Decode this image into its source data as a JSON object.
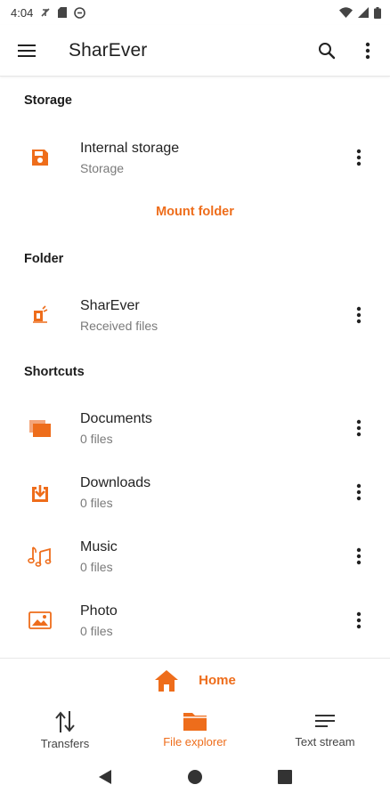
{
  "status_bar": {
    "time": "4:04"
  },
  "app_bar": {
    "title": "SharEver"
  },
  "sections": {
    "storage": {
      "title": "Storage",
      "items": [
        {
          "primary": "Internal storage",
          "secondary": "Storage",
          "icon": "save-icon"
        }
      ],
      "mount_label": "Mount folder"
    },
    "folder": {
      "title": "Folder",
      "items": [
        {
          "primary": "SharEver",
          "secondary": "Received files",
          "icon": "sharever-folder-icon"
        }
      ]
    },
    "shortcuts": {
      "title": "Shortcuts",
      "items": [
        {
          "primary": "Documents",
          "secondary": "0 files",
          "icon": "documents-icon"
        },
        {
          "primary": "Downloads",
          "secondary": "0 files",
          "icon": "download-icon"
        },
        {
          "primary": "Music",
          "secondary": "0 files",
          "icon": "music-icon"
        },
        {
          "primary": "Photo",
          "secondary": "0 files",
          "icon": "photo-icon"
        }
      ]
    }
  },
  "home_bar": {
    "label": "Home"
  },
  "bottom_nav": [
    {
      "label": "Transfers",
      "icon": "transfers-icon",
      "active": false
    },
    {
      "label": "File explorer",
      "icon": "folder-icon",
      "active": true
    },
    {
      "label": "Text stream",
      "icon": "text-lines-icon",
      "active": false
    }
  ],
  "colors": {
    "accent": "#ee6d1b",
    "text_primary": "#232323",
    "text_secondary": "#7a7a7a"
  }
}
